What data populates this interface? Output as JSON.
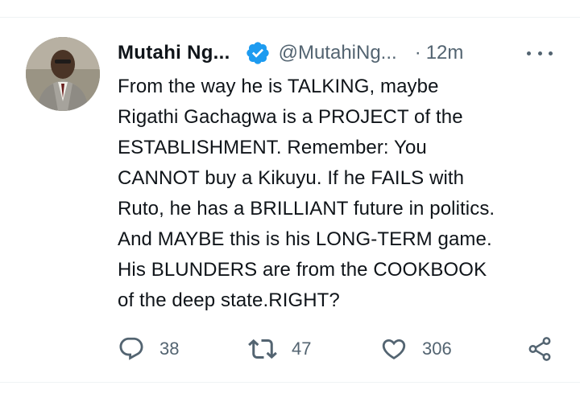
{
  "tweet": {
    "author_name": "Mutahi Ng...",
    "handle": "@MutahiNg...",
    "separator": "·",
    "time": "12m",
    "lines": [
      "From the way he is TALKING, maybe",
      "Rigathi Gachagwa is a PROJECT of the",
      "ESTABLISHMENT. Remember: You",
      "CANNOT buy a Kikuyu. If he FAILS with",
      "Ruto, he has a BRILLIANT future in politics.",
      "And MAYBE this is his LONG-TERM game.",
      "His BLUNDERS are from the COOKBOOK",
      "of the deep state.RIGHT?"
    ]
  },
  "actions": {
    "reply_count": "38",
    "retweet_count": "47",
    "like_count": "306"
  },
  "icons": {
    "verified": "verified-badge-icon",
    "more": "more-options-icon",
    "reply": "reply-icon",
    "retweet": "retweet-icon",
    "like": "heart-icon",
    "share": "share-icon"
  },
  "colors": {
    "verified_blue": "#1d9bf0",
    "text_primary": "#0f1419",
    "text_secondary": "#536471",
    "divider": "#eff3f4"
  }
}
